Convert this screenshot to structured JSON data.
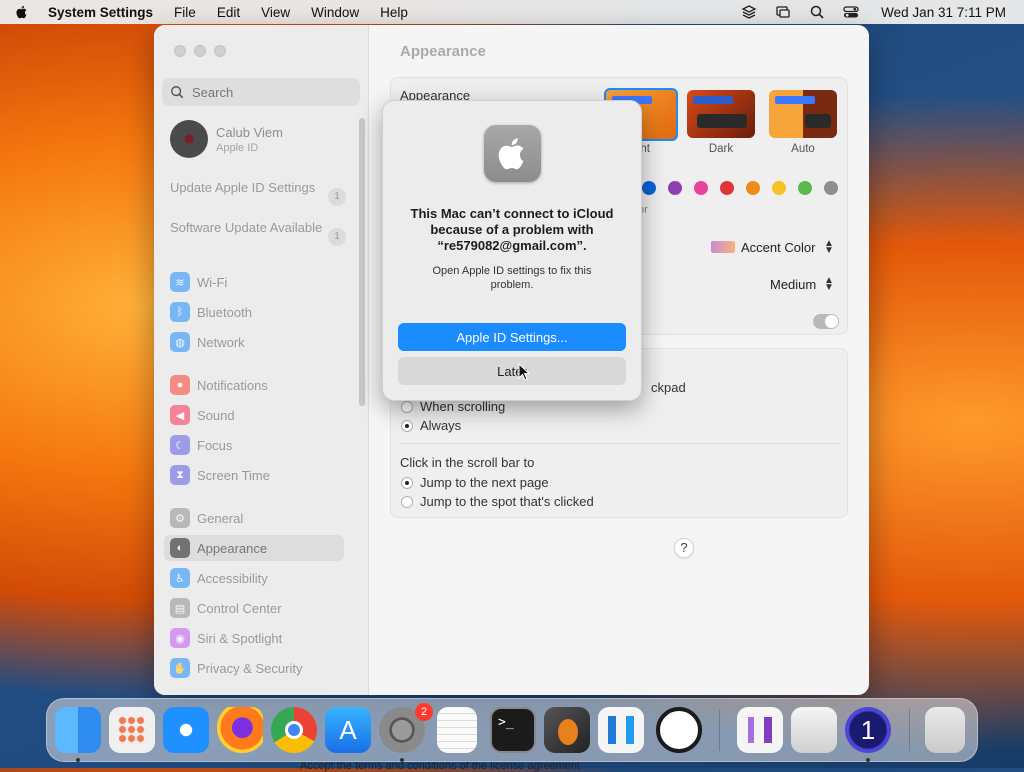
{
  "menubar": {
    "app_name": "System Settings",
    "items": [
      "File",
      "Edit",
      "View",
      "Window",
      "Help"
    ],
    "clock": "Wed Jan 31  7:11 PM"
  },
  "sidebar": {
    "search_placeholder": "Search",
    "account": {
      "name": "Calub Viem",
      "subtitle": "Apple ID"
    },
    "notices": [
      {
        "label": "Update Apple ID Settings",
        "badge": "1"
      },
      {
        "label": "Software Update Available",
        "badge": "1"
      }
    ],
    "items": [
      {
        "label": "Wi-Fi",
        "icon": "wifi-icon",
        "color": "#1a8cff"
      },
      {
        "label": "Bluetooth",
        "icon": "bluetooth-icon",
        "color": "#1a8cff"
      },
      {
        "label": "Network",
        "icon": "globe-icon",
        "color": "#1a8cff"
      },
      {
        "label": "Notifications",
        "icon": "bell-icon",
        "color": "#ff3b30"
      },
      {
        "label": "Sound",
        "icon": "speaker-icon",
        "color": "#ff2d55"
      },
      {
        "label": "Focus",
        "icon": "moon-icon",
        "color": "#5e5ce6"
      },
      {
        "label": "Screen Time",
        "icon": "hourglass-icon",
        "color": "#5e5ce6"
      },
      {
        "label": "General",
        "icon": "gear-icon",
        "color": "#8e8e93"
      },
      {
        "label": "Appearance",
        "icon": "appearance-icon",
        "color": "#1c1c1e"
      },
      {
        "label": "Accessibility",
        "icon": "accessibility-icon",
        "color": "#1a8cff"
      },
      {
        "label": "Control Center",
        "icon": "control-center-icon",
        "color": "#8e8e93"
      },
      {
        "label": "Siri & Spotlight",
        "icon": "siri-icon",
        "color": "#bf5af2"
      },
      {
        "label": "Privacy & Security",
        "icon": "hand-icon",
        "color": "#1a8cff"
      }
    ],
    "selected": "Appearance"
  },
  "content": {
    "title": "Appearance",
    "appearance_label": "Appearance",
    "modes": [
      "ht",
      "Dark",
      "Auto"
    ],
    "accent_partial": "or",
    "accent_colors": [
      "#0a64d6",
      "#8e3fae",
      "#e8449b",
      "#e0363a",
      "#f08a1c",
      "#f5c325",
      "#5bb84a",
      "#8e8e8e"
    ],
    "highlight_color": "Accent Color",
    "sidebar_icon_size": "Medium",
    "show_scroll_partial": "ckpad",
    "scroll_options": [
      {
        "label": "When scrolling",
        "selected": false
      },
      {
        "label": "Always",
        "selected": true
      }
    ],
    "click_label": "Click in the scroll bar to",
    "click_options": [
      {
        "label": "Jump to the next page",
        "selected": true
      },
      {
        "label": "Jump to the spot that's clicked",
        "selected": false
      }
    ],
    "help": "?"
  },
  "dialog": {
    "title": "This Mac can’t connect to iCloud because of a problem with “re579082@gmail.com”.",
    "message": "Open Apple ID settings to fix this problem.",
    "primary_button": "Apple ID Settings...",
    "secondary_button": "Later"
  },
  "dock": {
    "apps": [
      {
        "name": "finder-icon",
        "color": "#2f8cf0"
      },
      {
        "name": "launchpad-icon",
        "color": "#f0f0f0"
      },
      {
        "name": "safari-icon",
        "color": "#1e90ff"
      },
      {
        "name": "firefox-icon",
        "color": "#7b2fe0"
      },
      {
        "name": "chrome-icon",
        "color": "#f5f5f5"
      },
      {
        "name": "app-store-icon",
        "color": "#1a8cff"
      },
      {
        "name": "system-settings-icon",
        "color": "#7a7a7a"
      },
      {
        "name": "textedit-icon",
        "color": "#fafafa"
      },
      {
        "name": "terminal-icon",
        "color": "#1b1b1b"
      },
      {
        "name": "garageband-icon",
        "color": "#333"
      },
      {
        "name": "vscode-icon",
        "color": "#f5f5f5"
      },
      {
        "name": "clock-icon",
        "color": "#1b1b1b"
      },
      {
        "name": "visual-studio-icon",
        "color": "#f5f5f5"
      },
      {
        "name": "disk-utility-icon",
        "color": "#e8e8e8"
      },
      {
        "name": "onepassword-icon",
        "color": "#1a1a6e"
      },
      {
        "name": "trash-icon",
        "color": "#dcdcdc"
      }
    ],
    "settings_badge": "2"
  },
  "background_strip": "Accept the terms and conditions of the license agreement"
}
